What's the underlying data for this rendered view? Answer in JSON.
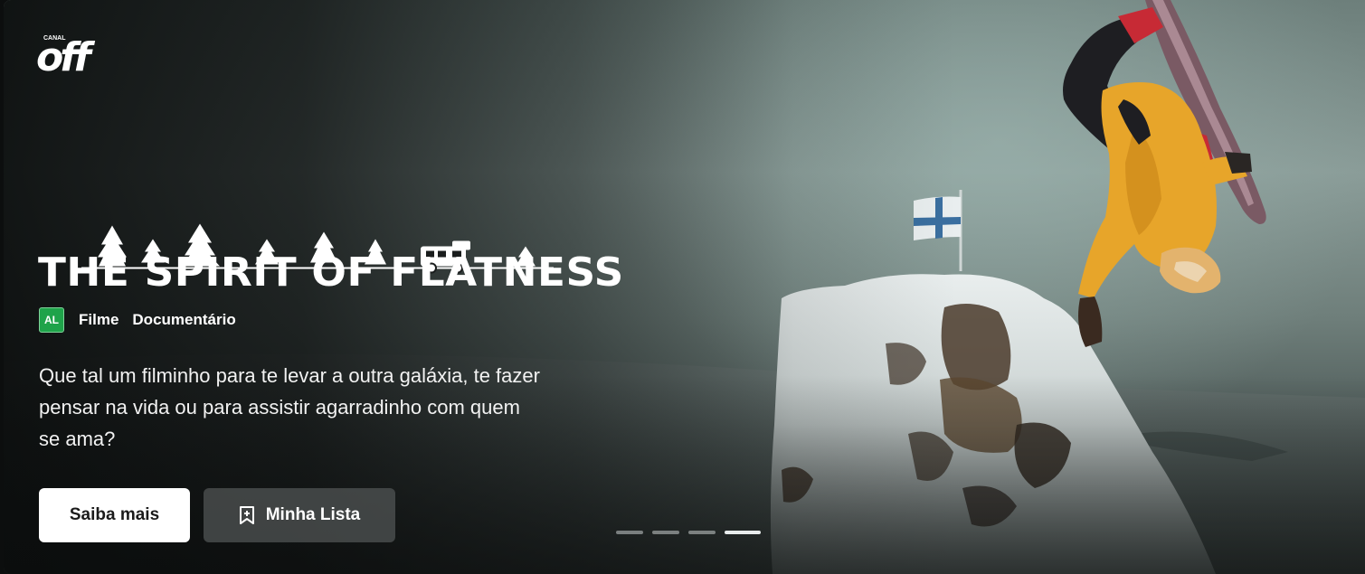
{
  "brand": {
    "logo_small_text": "CANAL",
    "logo_text": "off"
  },
  "hero": {
    "title": "THE SPIRIT OF FLATNESS",
    "rating": "AL",
    "tags": [
      "Filme",
      "Documentário"
    ],
    "description": "Que tal um filminho para te levar a outra galáxia, te fazer pensar na vida ou para assistir agarradinho com quem se ama?",
    "buttons": {
      "more_info": "Saiba mais",
      "my_list": "Minha Lista"
    },
    "carousel": {
      "total": 4,
      "active_index": 3
    }
  },
  "colors": {
    "rating_badge": "#1fa34a",
    "primary_button_bg": "#ffffff",
    "secondary_button_bg": "#505454",
    "jacket": "#e7a52a"
  },
  "icons": [
    "bookmark-plus-icon",
    "tree-icon",
    "camper-van-icon",
    "flag-icon"
  ]
}
